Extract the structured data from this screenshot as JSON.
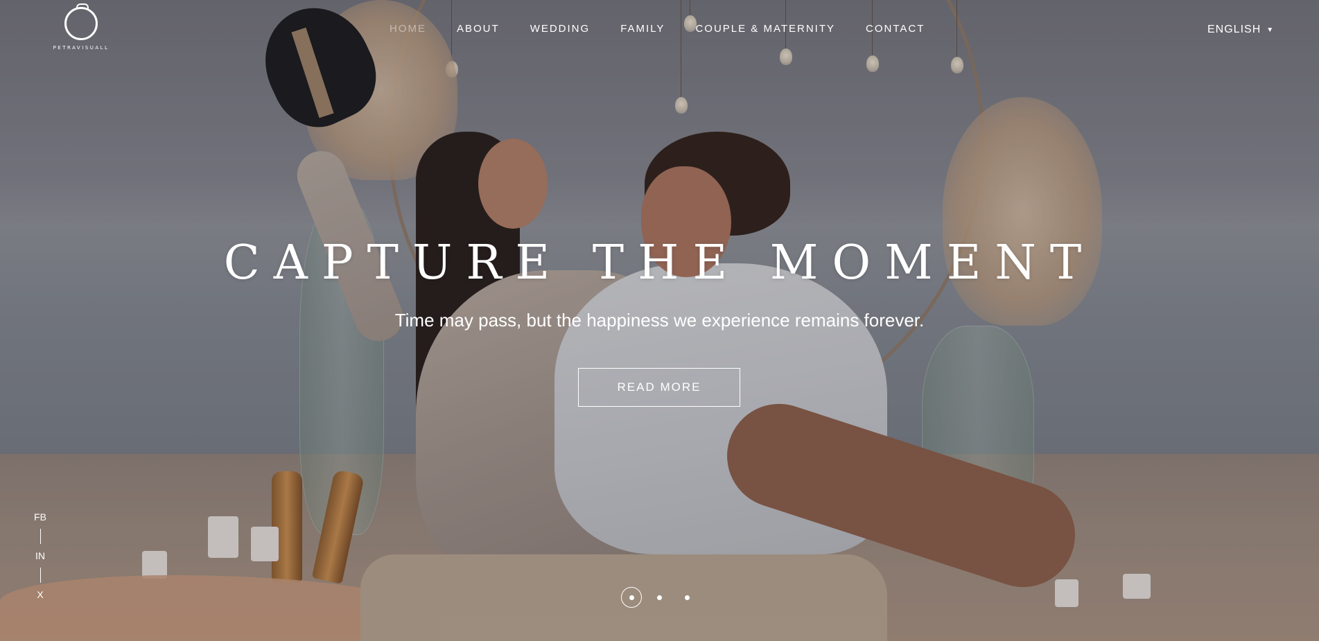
{
  "brand": {
    "logo_text": "PETRAVISUALL"
  },
  "nav": {
    "items": [
      {
        "label": "HOME",
        "active": true
      },
      {
        "label": "ABOUT",
        "active": false
      },
      {
        "label": "WEDDING",
        "active": false
      },
      {
        "label": "FAMILY",
        "active": false
      },
      {
        "label": "COUPLE & MATERNITY",
        "active": false
      },
      {
        "label": "CONTACT",
        "active": false
      }
    ]
  },
  "language": {
    "selected": "ENGLISH",
    "caret_icon": "caret-down-icon"
  },
  "hero": {
    "headline": "CAPTURE THE MOMENT",
    "subline": "Time may pass, but the happiness we experience remains forever.",
    "cta_label": "READ MORE"
  },
  "social": {
    "links": [
      "FB",
      "IN",
      "X"
    ]
  },
  "slider": {
    "slide_count": 3,
    "active_index": 0
  },
  "colors": {
    "text": "#ffffff",
    "nav_inactive": "#ffffff",
    "nav_active": "rgba(255,255,255,0.45)"
  }
}
